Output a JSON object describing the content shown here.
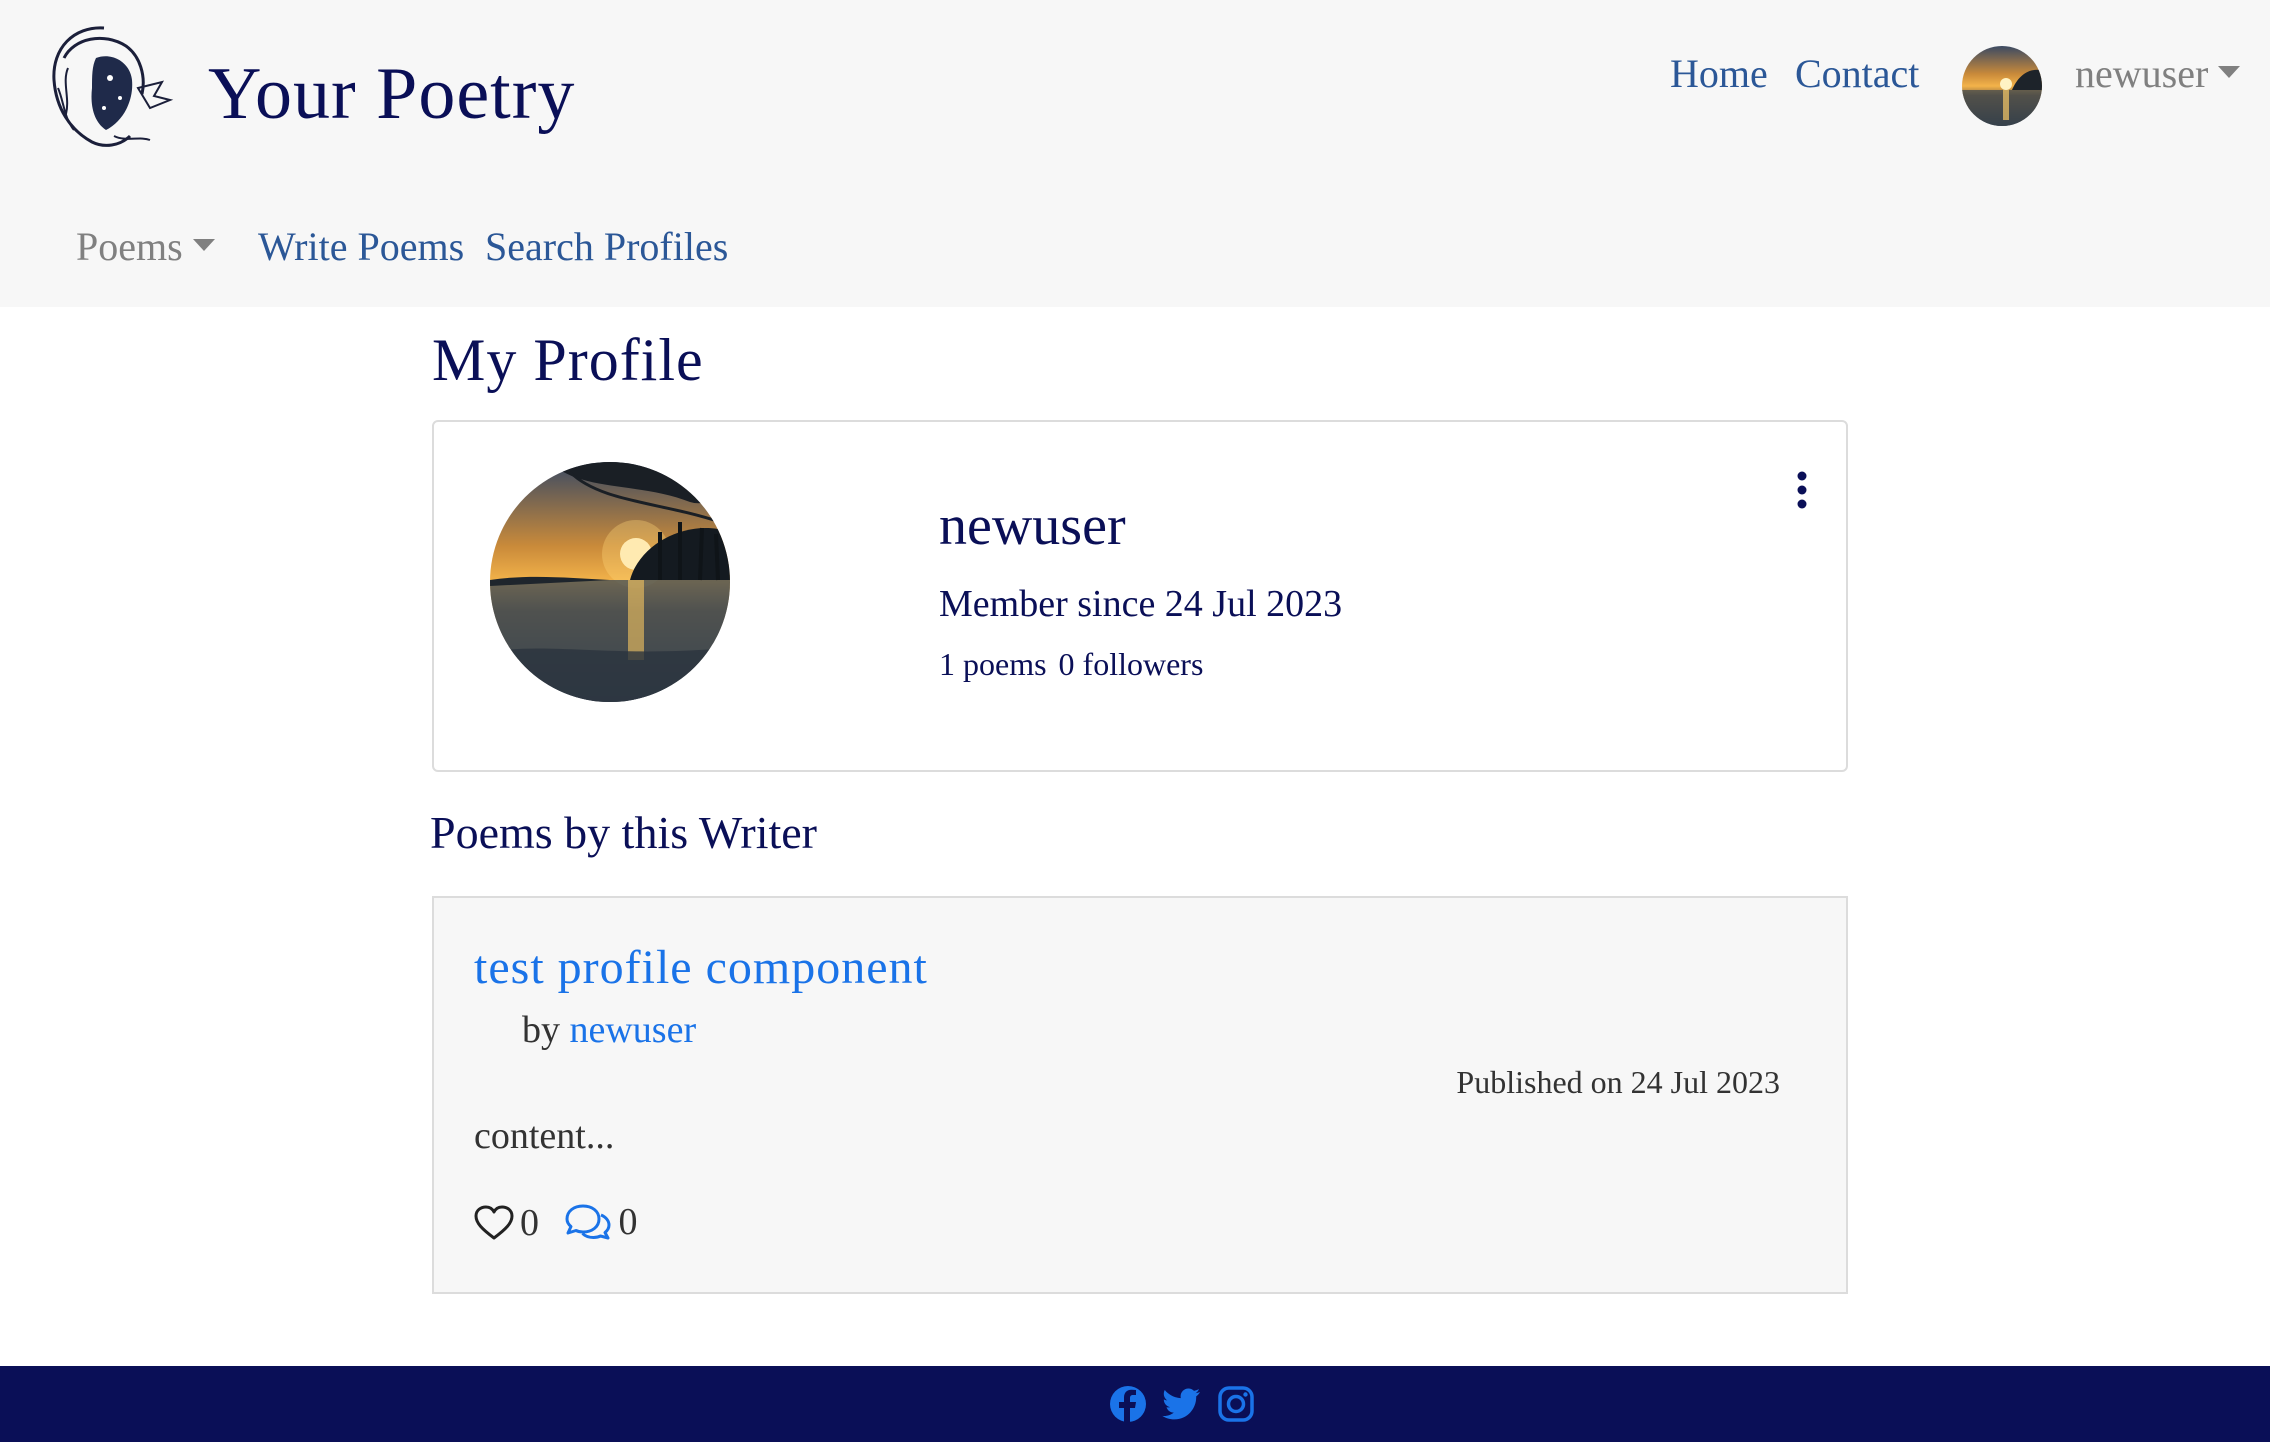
{
  "brand": {
    "title": "Your Poetry",
    "logo_icon": "poet-face-logo"
  },
  "nav": {
    "home": "Home",
    "contact": "Contact",
    "user": "newuser",
    "poems": "Poems",
    "write": "Write Poems",
    "search": "Search Profiles"
  },
  "page": {
    "title": "My Profile"
  },
  "profile": {
    "name": "newuser",
    "member_since": "Member since 24 Jul 2023",
    "poems": "1 poems",
    "followers": "0 followers"
  },
  "section": {
    "title": "Poems by this Writer"
  },
  "poems": [
    {
      "title": "test profile component",
      "by_label": "by",
      "author": "newuser",
      "published": "Published on 24 Jul 2023",
      "content": "content...",
      "likes": "0",
      "comments": "0"
    }
  ],
  "footer": {
    "icons": [
      "facebook-icon",
      "twitter-icon",
      "instagram-icon"
    ]
  },
  "colors": {
    "navy": "#0a0f57",
    "link": "#2b5797",
    "accent": "#1a73e8",
    "muted": "#808080"
  }
}
